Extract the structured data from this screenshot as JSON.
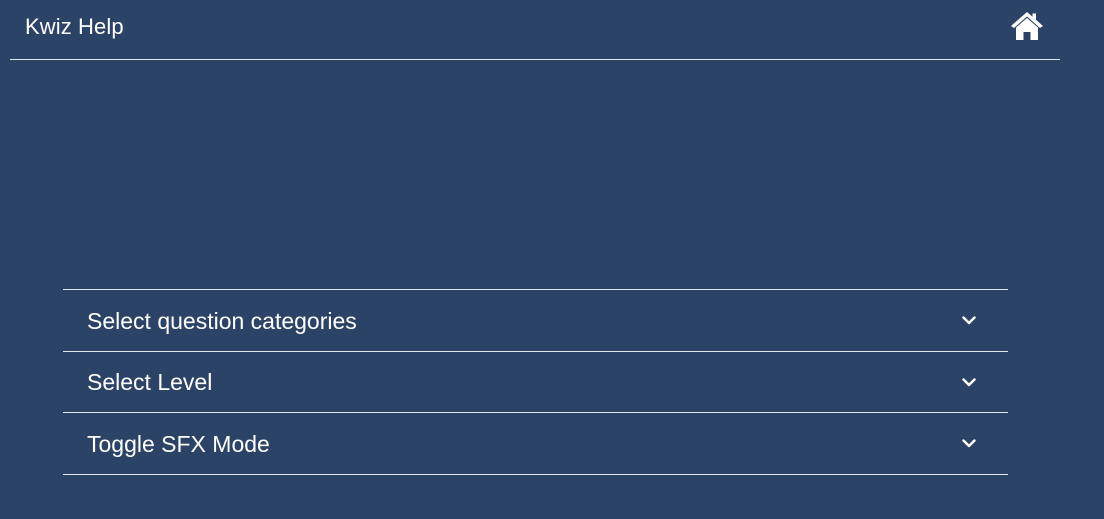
{
  "header": {
    "title": "Kwiz Help",
    "home_icon": "home-icon"
  },
  "accordion": {
    "items": [
      {
        "label": "Select question categories",
        "icon": "chevron-down-icon"
      },
      {
        "label": "Select Level",
        "icon": "chevron-down-icon"
      },
      {
        "label": "Toggle SFX Mode",
        "icon": "chevron-down-icon"
      }
    ]
  },
  "colors": {
    "background": "#2b4366",
    "text": "#ffffff",
    "divider": "#dfe6ef"
  }
}
